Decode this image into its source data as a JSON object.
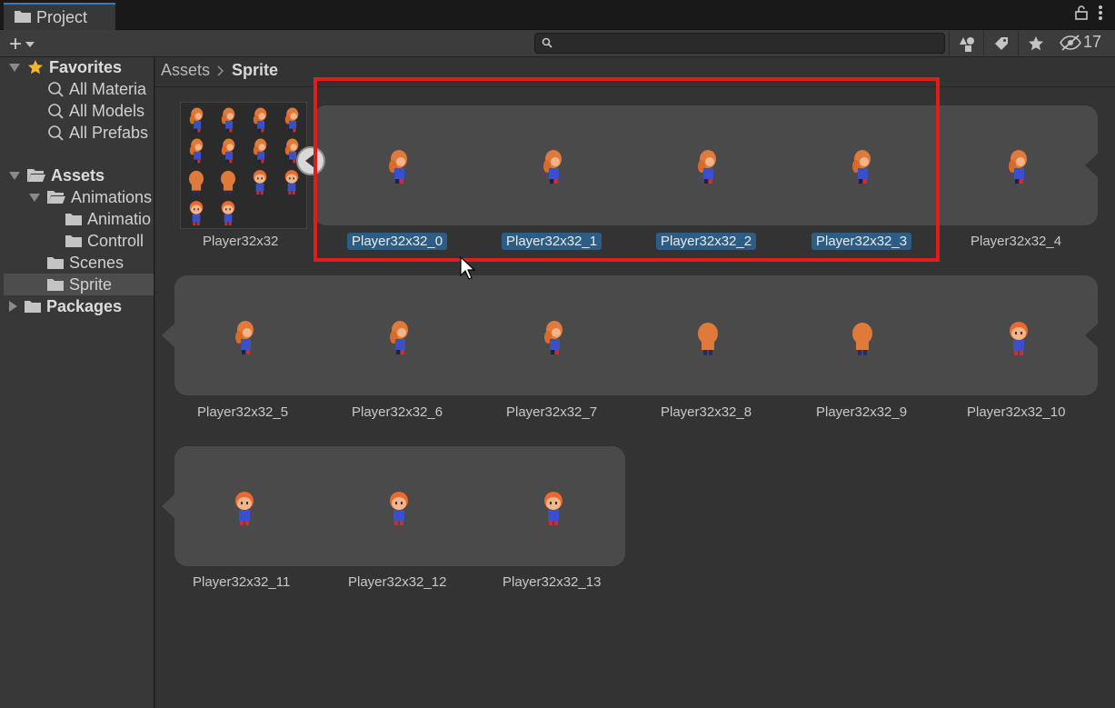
{
  "window": {
    "tab_title": "Project",
    "hidden_count": "17"
  },
  "toolbar": {
    "add_label": "+",
    "search_placeholder": "",
    "search_value": ""
  },
  "sidebar": {
    "favorites": {
      "label": "Favorites",
      "items": [
        "All Materia",
        "All Models",
        "All Prefabs"
      ]
    },
    "assets": {
      "label": "Assets",
      "children": [
        "Animations",
        "Animatio",
        "Controll",
        "Scenes",
        "Sprite"
      ]
    },
    "packages": {
      "label": "Packages"
    }
  },
  "breadcrumb": {
    "root": "Assets",
    "current": "Sprite"
  },
  "grid": {
    "sheet_label": "Player32x32",
    "row1": [
      "Player32x32_0",
      "Player32x32_1",
      "Player32x32_2",
      "Player32x32_3",
      "Player32x32_4"
    ],
    "row2": [
      "Player32x32_5",
      "Player32x32_6",
      "Player32x32_7",
      "Player32x32_8",
      "Player32x32_9",
      "Player32x32_10"
    ],
    "row3": [
      "Player32x32_11",
      "Player32x32_12",
      "Player32x32_13"
    ],
    "selected": [
      "Player32x32_0",
      "Player32x32_1",
      "Player32x32_2",
      "Player32x32_3"
    ]
  },
  "colors": {
    "selection": "#2c5d87",
    "highlight_box": "#e21b1b",
    "strip": "#4a4a4a"
  }
}
